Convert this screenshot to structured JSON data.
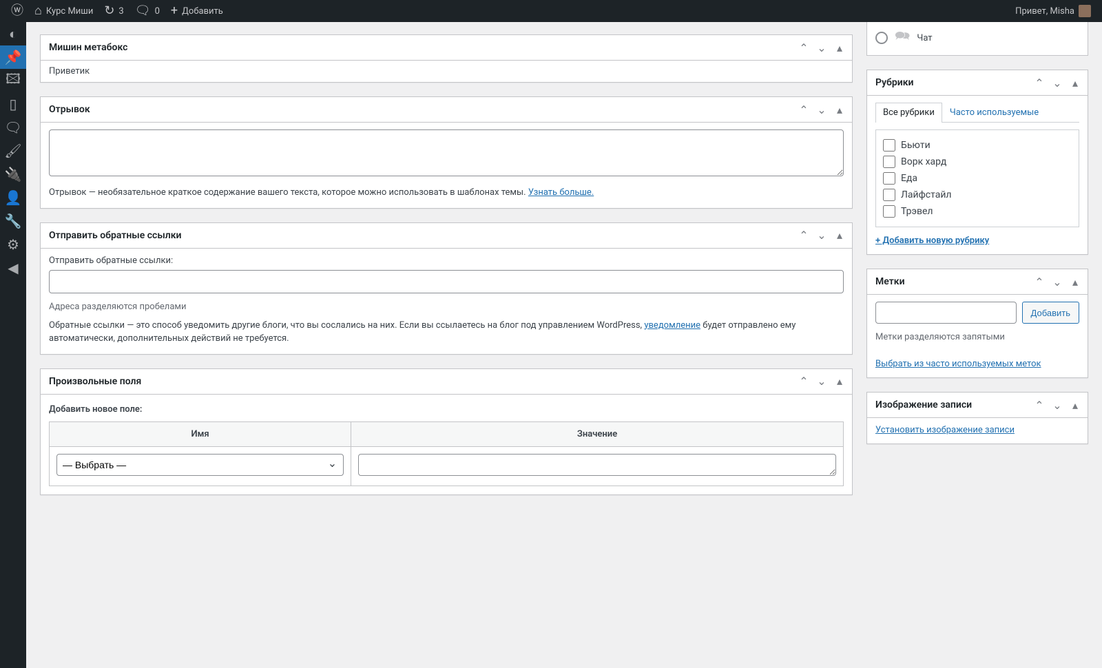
{
  "adminbar": {
    "site_name": "Курс Миши",
    "updates_count": "3",
    "comments_count": "0",
    "add_new": "Добавить",
    "greeting": "Привет, Misha"
  },
  "metabox_custom": {
    "title": "Мишин метабокс",
    "content": "Приветик"
  },
  "excerpt": {
    "title": "Отрывок",
    "value": "",
    "desc_before": "Отрывок — необязательное краткое содержание вашего текста, которое можно использовать в шаблонах темы. ",
    "link": "Узнать больше."
  },
  "trackbacks": {
    "title": "Отправить обратные ссылки",
    "label": "Отправить обратные ссылки:",
    "value": "",
    "note": "Адреса разделяются пробелами",
    "desc1": "Обратные ссылки — это способ уведомить другие блоги, что вы сослались на них. Если вы ссылаетесь на блог под управлением WordPress, ",
    "link": "уведомление",
    "desc2": " будет отправлено ему автоматически, дополнительных действий не требуется."
  },
  "customfields": {
    "title": "Произвольные поля",
    "add_label": "Добавить новое поле:",
    "col_name": "Имя",
    "col_value": "Значение",
    "select_placeholder": "— Выбрать —"
  },
  "chat": {
    "label": "Чат"
  },
  "categories": {
    "title": "Рубрики",
    "tab_all": "Все рубрики",
    "tab_pop": "Часто используемые",
    "items": [
      "Бьюти",
      "Ворк хард",
      "Еда",
      "Лайфстайл",
      "Трэвел"
    ],
    "add_link": "+ Добавить новую рубрику"
  },
  "tags": {
    "title": "Метки",
    "button": "Добавить",
    "note": "Метки разделяются запятыми",
    "choose_link": "Выбрать из часто используемых меток"
  },
  "thumbnail": {
    "title": "Изображение записи",
    "set_link": "Установить изображение записи"
  }
}
